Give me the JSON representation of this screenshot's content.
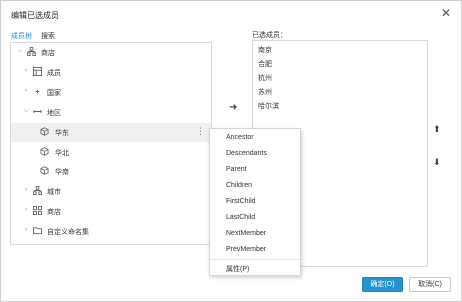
{
  "dialog": {
    "title": "编辑已选成员",
    "close_icon": "close-icon"
  },
  "tabs": [
    {
      "label": "成员树",
      "active": true
    },
    {
      "label": "搜索",
      "active": false
    }
  ],
  "tree": [
    {
      "label": "商店",
      "level": 0,
      "expanded": true,
      "icon": "hierarchy-icon"
    },
    {
      "label": "成员",
      "level": 1,
      "expanded": false,
      "icon": "member-table-icon"
    },
    {
      "label": "国家",
      "level": 1,
      "expanded": false,
      "icon": "plus-level-icon"
    },
    {
      "label": "地区",
      "level": 1,
      "expanded": true,
      "icon": "level-icon"
    },
    {
      "label": "华东",
      "level": 2,
      "selected": true,
      "icon": "cube-icon"
    },
    {
      "label": "华北",
      "level": 2,
      "icon": "cube-icon"
    },
    {
      "label": "华南",
      "level": 2,
      "icon": "cube-icon"
    },
    {
      "label": "城市",
      "level": 1,
      "expanded": false,
      "icon": "hierarchy-icon"
    },
    {
      "label": "商店",
      "level": 1,
      "expanded": false,
      "icon": "grid-icon"
    },
    {
      "label": "自定义命名集",
      "level": 1,
      "expanded": false,
      "icon": "folder-icon"
    }
  ],
  "selected_panel": {
    "label": "已选成员：",
    "items": [
      "南京",
      "合肥",
      "杭州",
      "苏州",
      "哈尔滨"
    ]
  },
  "context_menu": {
    "items": [
      "Ancestor",
      "Descendants",
      "Parent",
      "Children",
      "FirstChild",
      "LastChild",
      "NextMember",
      "PrevMember"
    ],
    "properties": "属性(P)"
  },
  "buttons": {
    "ok": "确定(O)",
    "cancel": "取消(C)"
  },
  "colors": {
    "accent": "#1a8fd6",
    "ok_bg": "#2593d0",
    "selected_row": "#f0f0f0"
  }
}
